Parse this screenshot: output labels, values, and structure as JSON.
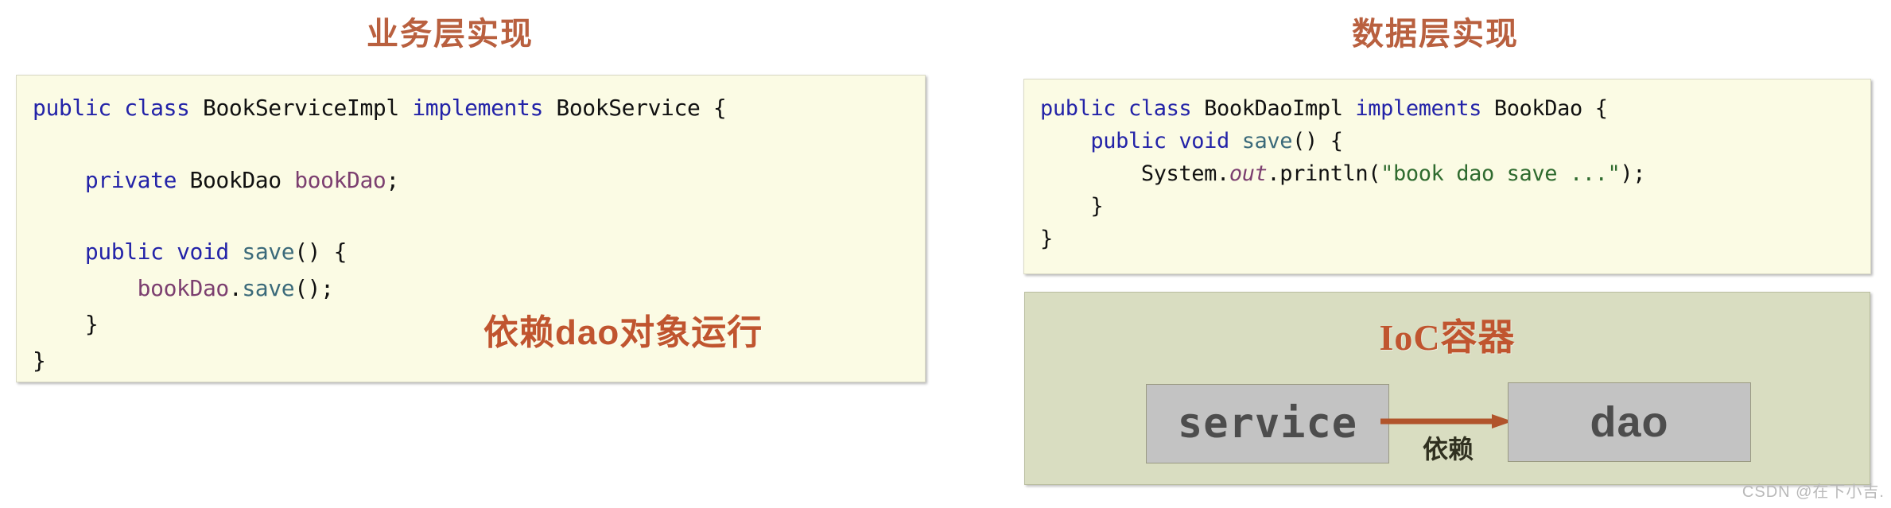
{
  "panels": {
    "left": {
      "title": "业务层实现",
      "overlay_note": "依赖dao对象运行",
      "code_lines": [
        "public class BookServiceImpl implements BookService {",
        "",
        "    private BookDao bookDao;",
        "",
        "    public void save() {",
        "        bookDao.save();",
        "    }",
        "}"
      ]
    },
    "right": {
      "title": "数据层实现",
      "code_lines": [
        "public class BookDaoImpl implements BookDao {",
        "    public void save() {",
        "        System.out.println(\"book dao save ...\");",
        "    }",
        "}"
      ]
    }
  },
  "ioc": {
    "title": "IoC容器",
    "bean_service": "service",
    "bean_dao": "dao",
    "arrow_label": "依赖",
    "arrow_icon": "arrow-right-icon"
  },
  "watermark": "CSDN @在下小吉.",
  "colors": {
    "title_red": "#b9603f",
    "note_red": "#c0552f",
    "code_bg": "#fbfbe4",
    "ioc_bg": "#d9ddc1",
    "bean_bg": "#c3c3c3",
    "arrow": "#b1542b",
    "keyword_blue": "#2323a8",
    "field_purple": "#7c3f70",
    "method_teal": "#3b6a7a",
    "string_green": "#2f6b2f"
  }
}
